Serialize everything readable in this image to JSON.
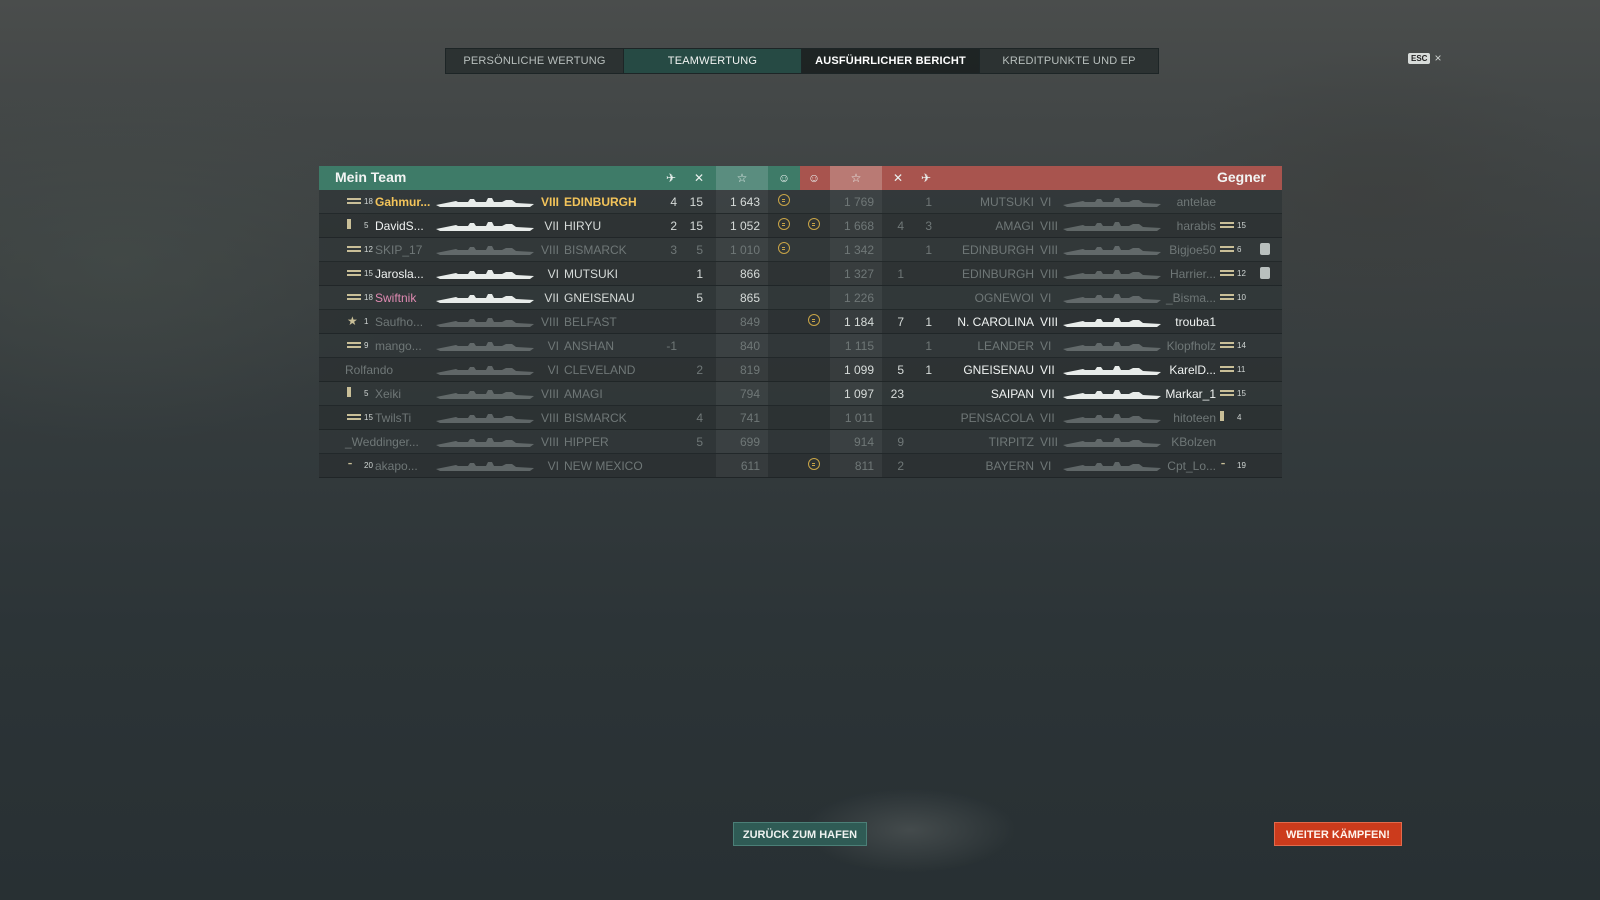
{
  "tabs": [
    {
      "label": "PERSÖNLICHE WERTUNG",
      "state": "normal"
    },
    {
      "label": "TEAMWERTUNG",
      "state": "team"
    },
    {
      "label": "AUSFÜHRLICHER BERICHT",
      "state": "selected"
    },
    {
      "label": "KREDITPUNKTE UND EP",
      "state": "normal"
    }
  ],
  "esc": {
    "key": "ESC",
    "close": "×"
  },
  "my_team": {
    "title": "Mein Team",
    "color": "#3e7b68",
    "icons": [
      "planes-destroyed-icon",
      "ships-destroyed-icon",
      "score-star-icon",
      "capture-icon"
    ],
    "players": [
      {
        "rank_icon": "rank-stripes",
        "level": "18",
        "name": "Gahmur...",
        "tier": "VIII",
        "ship": "EDINBURGH",
        "planes": "4",
        "kills": "15",
        "score": "1 643",
        "capture": true,
        "style": "gold",
        "dead": false
      },
      {
        "rank_icon": "rank-single",
        "level": "5",
        "name": "DavidS...",
        "tier": "VII",
        "ship": "HIRYU",
        "planes": "2",
        "kills": "15",
        "score": "1 052",
        "capture": true,
        "style": "white",
        "dead": false
      },
      {
        "rank_icon": "rank-stripes",
        "level": "12",
        "name": "SKIP_17",
        "tier": "VIII",
        "ship": "BISMARCK",
        "planes": "3",
        "kills": "5",
        "score": "1 010",
        "capture": true,
        "style": "normal",
        "dead": true
      },
      {
        "rank_icon": "rank-stripes",
        "level": "15",
        "name": "Jarosla...",
        "tier": "VI",
        "ship": "MUTSUKI",
        "planes": "",
        "kills": "1",
        "score": "866",
        "capture": false,
        "style": "white",
        "dead": false
      },
      {
        "rank_icon": "rank-stripes",
        "level": "18",
        "name": "Swiftnik",
        "tier": "VII",
        "ship": "GNEISENAU",
        "planes": "",
        "kills": "5",
        "score": "865",
        "capture": false,
        "style": "pink",
        "dead": false
      },
      {
        "rank_icon": "rank-stars",
        "level": "1",
        "name": "Saufho...",
        "tier": "VIII",
        "ship": "BELFAST",
        "planes": "",
        "kills": "",
        "score": "849",
        "capture": false,
        "style": "normal",
        "dead": true
      },
      {
        "rank_icon": "rank-stripes",
        "level": "9",
        "name": "mango...",
        "tier": "VI",
        "ship": "ANSHAN",
        "planes": "-1",
        "kills": "",
        "score": "840",
        "capture": false,
        "style": "normal",
        "dead": true
      },
      {
        "rank_icon": "",
        "level": "",
        "name": "Rolfando",
        "tier": "VI",
        "ship": "CLEVELAND",
        "planes": "",
        "kills": "2",
        "score": "819",
        "capture": false,
        "style": "normal",
        "dead": true
      },
      {
        "rank_icon": "rank-single",
        "level": "5",
        "name": "Xeiki",
        "tier": "VIII",
        "ship": "AMAGI",
        "planes": "",
        "kills": "",
        "score": "794",
        "capture": false,
        "style": "normal",
        "dead": true
      },
      {
        "rank_icon": "rank-stripes",
        "level": "15",
        "name": "TwilsTi",
        "tier": "VIII",
        "ship": "BISMARCK",
        "planes": "",
        "kills": "4",
        "score": "741",
        "capture": false,
        "style": "normal",
        "dead": true
      },
      {
        "rank_icon": "",
        "level": "",
        "name": "_Weddinger...",
        "tier": "VIII",
        "ship": "HIPPER",
        "planes": "",
        "kills": "5",
        "score": "699",
        "capture": false,
        "style": "normal",
        "dead": true
      },
      {
        "rank_icon": "rank-single-stripe",
        "level": "20",
        "name": "akapo...",
        "tier": "VI",
        "ship": "NEW MEXICO",
        "planes": "",
        "kills": "",
        "score": "611",
        "capture": false,
        "style": "normal",
        "dead": true
      }
    ]
  },
  "enemy_team": {
    "title": "Gegner",
    "color": "#a8544e",
    "icons": [
      "capture-icon",
      "score-star-icon",
      "ships-destroyed-icon",
      "planes-destroyed-icon"
    ],
    "players": [
      {
        "capture": false,
        "score": "1 769",
        "kills": "",
        "planes": "1",
        "ship": "MUTSUKI",
        "tier": "VI",
        "name": "antelae",
        "rank_icon": "",
        "level": "",
        "division": false,
        "dead": true
      },
      {
        "capture": true,
        "score": "1 668",
        "kills": "4",
        "planes": "3",
        "ship": "AMAGI",
        "tier": "VIII",
        "name": "harabis",
        "rank_icon": "rank-stripes",
        "level": "15",
        "division": false,
        "dead": true
      },
      {
        "capture": false,
        "score": "1 342",
        "kills": "",
        "planes": "1",
        "ship": "EDINBURGH",
        "tier": "VIII",
        "name": "Bigjoe50",
        "rank_icon": "rank-stripes",
        "level": "6",
        "division": true,
        "dead": true
      },
      {
        "capture": false,
        "score": "1 327",
        "kills": "1",
        "planes": "",
        "ship": "EDINBURGH",
        "tier": "VIII",
        "name": "Harrier...",
        "rank_icon": "rank-stripes",
        "level": "12",
        "division": true,
        "dead": true
      },
      {
        "capture": false,
        "score": "1 226",
        "kills": "",
        "planes": "",
        "ship": "OGNEWOI",
        "tier": "VI",
        "name": "_Bisma...",
        "rank_icon": "rank-stripes",
        "level": "10",
        "division": false,
        "dead": true
      },
      {
        "capture": true,
        "score": "1 184",
        "kills": "7",
        "planes": "1",
        "ship": "N. CAROLINA",
        "tier": "VIII",
        "name": "trouba1",
        "rank_icon": "",
        "level": "",
        "division": false,
        "dead": false
      },
      {
        "capture": false,
        "score": "1 115",
        "kills": "",
        "planes": "1",
        "ship": "LEANDER",
        "tier": "VI",
        "name": "Klopfholz",
        "rank_icon": "rank-stripes",
        "level": "14",
        "division": false,
        "dead": true
      },
      {
        "capture": false,
        "score": "1 099",
        "kills": "5",
        "planes": "1",
        "ship": "GNEISENAU",
        "tier": "VII",
        "name": "KarelD...",
        "rank_icon": "rank-stripes",
        "level": "11",
        "division": false,
        "dead": false
      },
      {
        "capture": false,
        "score": "1 097",
        "kills": "23",
        "planes": "",
        "ship": "SAIPAN",
        "tier": "VII",
        "name": "Markar_1",
        "rank_icon": "rank-stripes",
        "level": "15",
        "division": false,
        "dead": false
      },
      {
        "capture": false,
        "score": "1 011",
        "kills": "",
        "planes": "",
        "ship": "PENSACOLA",
        "tier": "VII",
        "name": "hitoteen",
        "rank_icon": "rank-bars",
        "level": "4",
        "division": false,
        "dead": true
      },
      {
        "capture": false,
        "score": "914",
        "kills": "9",
        "planes": "",
        "ship": "TIRPITZ",
        "tier": "VIII",
        "name": "KBolzen",
        "rank_icon": "",
        "level": "",
        "division": false,
        "dead": true
      },
      {
        "capture": true,
        "score": "811",
        "kills": "2",
        "planes": "",
        "ship": "BAYERN",
        "tier": "VI",
        "name": "Cpt_Lo...",
        "rank_icon": "rank-single-stripe",
        "level": "19",
        "division": false,
        "dead": true
      }
    ]
  },
  "buttons": {
    "port": "ZURÜCK ZUM HAFEN",
    "fight": "WEITER KÄMPFEN!"
  }
}
